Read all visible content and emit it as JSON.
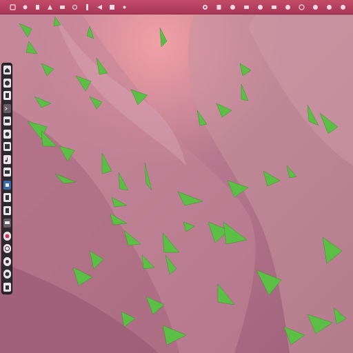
{
  "desktop": {
    "wallpaper": "pink-canyon-with-green-leaves",
    "colors": {
      "panel": "#b23f5e",
      "wallpaper_base": "#b97a92",
      "leaf": "#5bbf45",
      "launcher": "#2f2a30"
    }
  },
  "top_panel": {
    "left_icons": [
      "app-icon",
      "app-icon",
      "app-icon",
      "app-icon",
      "app-icon",
      "app-icon",
      "app-icon",
      "app-icon",
      "app-icon",
      "app-icon"
    ],
    "tray_icons": [
      "network-icon",
      "notification-icon",
      "sound-icon",
      "chat-icon",
      "battery-icon",
      "mail-icon",
      "user-icon",
      "clock-icon",
      "settings-icon",
      "power-icon",
      "session-icon"
    ]
  },
  "launcher": {
    "items": [
      "home-folder-icon",
      "browser-icon",
      "document-icon",
      "terminal-icon",
      "mail-icon",
      "settings-icon",
      "photos-icon",
      "music-icon",
      "files-icon",
      "store-icon",
      "text-editor-icon",
      "calculator-icon",
      "monitor-icon",
      "record-icon",
      "clock-icon",
      "camera-icon",
      "disk-icon",
      "trash-icon"
    ]
  }
}
